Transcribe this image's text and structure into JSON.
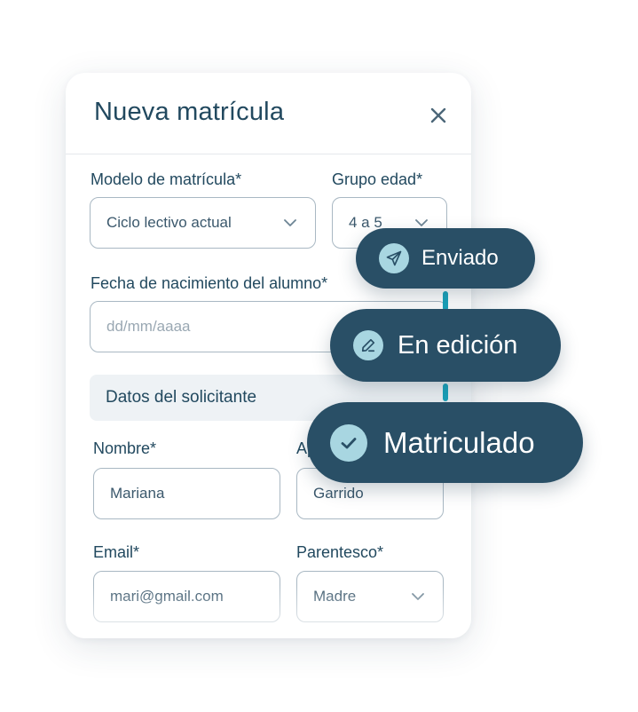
{
  "modal": {
    "title": "Nueva matrícula",
    "close_icon": "close-icon"
  },
  "form": {
    "modelo": {
      "label": "Modelo de matrícula*",
      "value": "Ciclo lectivo actual"
    },
    "grupo": {
      "label": "Grupo edad*",
      "value": "4 a 5"
    },
    "fecha": {
      "label": "Fecha de nacimiento del alumno*",
      "placeholder": "dd/mm/aaaa"
    },
    "section_title": "Datos  del solicitante",
    "nombre": {
      "label": "Nombre*",
      "value": "Mariana"
    },
    "apellido": {
      "label": "Apellido*",
      "value": "Garrido"
    },
    "email": {
      "label": "Email*",
      "value": "mari@gmail.com"
    },
    "parentesco": {
      "label": "Parentesco*",
      "value": "Madre"
    }
  },
  "statuses": [
    {
      "label": "Enviado",
      "icon": "send-icon"
    },
    {
      "label": "En edición",
      "icon": "pencil-icon"
    },
    {
      "label": "Matriculado",
      "icon": "check-icon"
    }
  ],
  "colors": {
    "primary": "#294f66",
    "icon_bg": "#a8d6e1",
    "connector": "#1aa3bb",
    "border": "#a9b8c3"
  }
}
